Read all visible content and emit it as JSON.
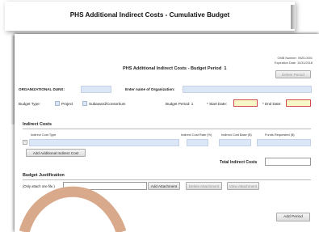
{
  "back_sheet": {
    "title": "PHS Additional Indirect Costs - Cumulative Budget"
  },
  "header": {
    "omb_number": "OMB Number: 0925-0001",
    "expiration": "Expiration Date: 10/31/2018",
    "title": "PHS Additional Indirect Costs - Budget Period",
    "period_number": "1",
    "delete_period_label": "Delete Period"
  },
  "org": {
    "duns_label": "ORGANIZATIONAL DUNS:",
    "duns_value": "",
    "name_label": "Enter name of Organization:",
    "name_value": ""
  },
  "budget": {
    "type_label": "Budget Type:",
    "type_options": [
      "Project",
      "Subaward/Consortium"
    ],
    "period_label": "Budget Period:",
    "period_value": "1",
    "start_label": "* Start Date:",
    "start_value": "",
    "end_label": "* End Date:",
    "end_value": ""
  },
  "indirect": {
    "section_title": "Indirect Costs",
    "col_type": "Indirect Cost Type",
    "col_rate": "Indirect Cost Rate (%)",
    "col_base": "Indirect Cost Base ($)",
    "col_requested": "Funds Requested ($)",
    "row_marker": "−",
    "add_button": "Add Additional Indirect Cost",
    "total_label": "Total Indirect Costs",
    "total_value": ""
  },
  "justification": {
    "section_title": "Budget Justification",
    "hint": "(Only attach one file.)",
    "file_value": "",
    "add_attachment": "Add Attachment",
    "delete_attachment": "Delete Attachment",
    "view_attachment": "View Attachment"
  },
  "footer": {
    "add_period_label": "Add Period"
  },
  "colors": {
    "field_fill": "#dbe6f7",
    "required_border": "#d24a4a",
    "required_fill": "#f7f7c8",
    "overlay_arc": "#d9a98b"
  }
}
